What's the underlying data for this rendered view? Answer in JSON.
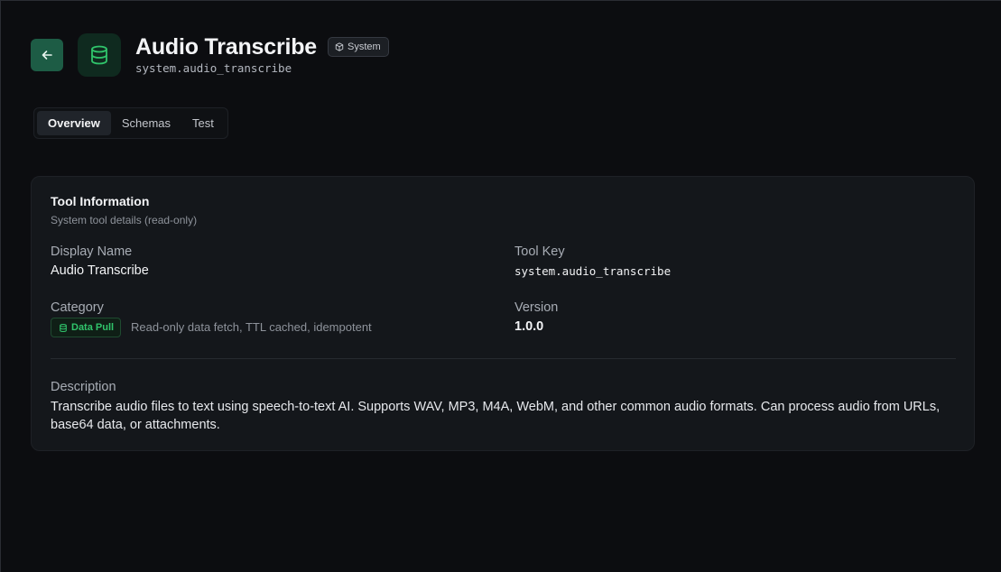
{
  "header": {
    "title": "Audio Transcribe",
    "badge": "System",
    "subtitle": "system.audio_transcribe"
  },
  "tabs": [
    {
      "label": "Overview",
      "active": true
    },
    {
      "label": "Schemas",
      "active": false
    },
    {
      "label": "Test",
      "active": false
    }
  ],
  "card": {
    "title": "Tool Information",
    "subtitle": "System tool details (read-only)",
    "display_name_label": "Display Name",
    "display_name_value": "Audio Transcribe",
    "tool_key_label": "Tool Key",
    "tool_key_value": "system.audio_transcribe",
    "category_label": "Category",
    "category_badge": "Data Pull",
    "category_description": "Read-only data fetch, TTL cached, idempotent",
    "version_label": "Version",
    "version_value": "1.0.0",
    "description_label": "Description",
    "description_value": "Transcribe audio files to text using speech-to-text AI. Supports WAV, MP3, M4A, WebM, and other common audio formats. Can process audio from URLs, base64 data, or attachments."
  },
  "icons": {
    "back": "arrow-left-icon",
    "tool": "database-icon",
    "badge": "box-icon",
    "category": "database-icon"
  },
  "colors": {
    "accent_green": "#30c46b",
    "back_button": "#1d5c45",
    "background": "#0c0d10",
    "card": "#14171b"
  }
}
